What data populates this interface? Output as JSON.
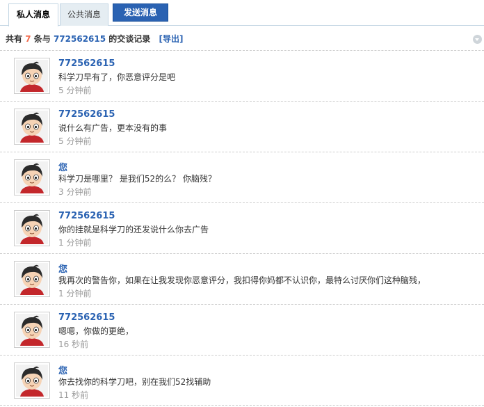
{
  "tabs": {
    "private_label": "私人消息",
    "public_label": "公共消息",
    "send_label": "发送消息"
  },
  "summary": {
    "prefix": "共有",
    "count": "7",
    "middle": "条与",
    "uid": "772562615",
    "suffix": "的交谈记录",
    "export_label": "[导出]"
  },
  "messages": [
    {
      "author": "772562615",
      "text": "科学刀早有了，你恶意评分是吧",
      "time": "5 分钟前"
    },
    {
      "author": "772562615",
      "text": "说什么有广告，更本没有的事",
      "time": "5 分钟前"
    },
    {
      "author": "您",
      "text": "科学刀是哪里？ 是我们52的么？ 你脑残？",
      "time": "3 分钟前"
    },
    {
      "author": "772562615",
      "text": "你的挂就是科学刀的还发说什么你去广告",
      "time": "1 分钟前"
    },
    {
      "author": "您",
      "text": "我再次的警告你，如果在让我发现你恶意评分，我扣得你妈都不认识你，最特么讨厌你们这种脑残，",
      "time": "1 分钟前"
    },
    {
      "author": "772562615",
      "text": "嗯嗯，你做的更绝，",
      "time": "16 秒前"
    },
    {
      "author": "您",
      "text": "你去找你的科学刀吧，别在我们52找辅助",
      "time": "11 秒前"
    }
  ],
  "colors": {
    "link_blue": "#2a62b2",
    "count_orange": "#f26c4f",
    "time_gray": "#999999",
    "tab_bg": "#e5edf2",
    "border": "#c2d5e3"
  },
  "icons": {
    "avatar": "avatar-cartoon-boy-icon",
    "collapse": "collapse-chevron-icon"
  }
}
